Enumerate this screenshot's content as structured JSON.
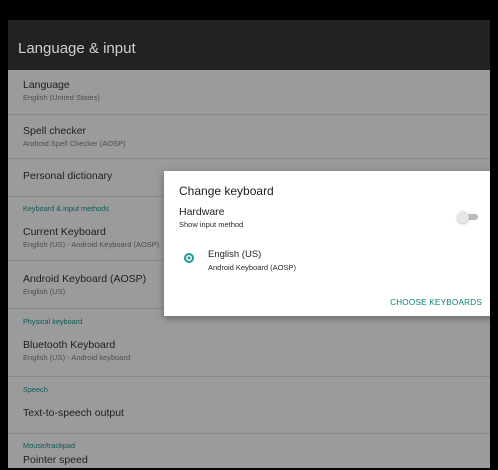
{
  "app": {
    "title": "Language & input"
  },
  "list": {
    "language": {
      "title": "Language",
      "subtitle": "English (United States)"
    },
    "spell_checker": {
      "title": "Spell checker",
      "subtitle": "Android Spell Checker (AOSP)"
    },
    "personal_dictionary": {
      "title": "Personal dictionary"
    },
    "section_keyboard_input": "Keyboard & input methods",
    "current_keyboard": {
      "title": "Current Keyboard",
      "subtitle": "English (US) - Android Keyboard (AOSP)"
    },
    "android_keyboard": {
      "title": "Android Keyboard (AOSP)",
      "subtitle": "English (US)"
    },
    "section_physical_keyboard": "Physical keyboard",
    "bluetooth_keyboard": {
      "title": "Bluetooth Keyboard",
      "subtitle": "English (US) - Android keyboard"
    },
    "section_speech": "Speech",
    "tts_output": {
      "title": "Text-to-speech output"
    },
    "section_mouse": "Mouse/trackpad",
    "pointer_speed": {
      "title": "Pointer speed"
    }
  },
  "dialog": {
    "title": "Change keyboard",
    "hardware_title": "Hardware",
    "hardware_subtitle": "Show input method",
    "hardware_toggle_on": false,
    "keyboard_option": {
      "title": "English (US)",
      "subtitle": "Android Keyboard (AOSP)",
      "selected": true
    },
    "choose_keyboards_label": "CHOOSE KEYBOARDS"
  },
  "colors": {
    "accent": "#1a9b95",
    "section_text": "#0b5a57"
  }
}
